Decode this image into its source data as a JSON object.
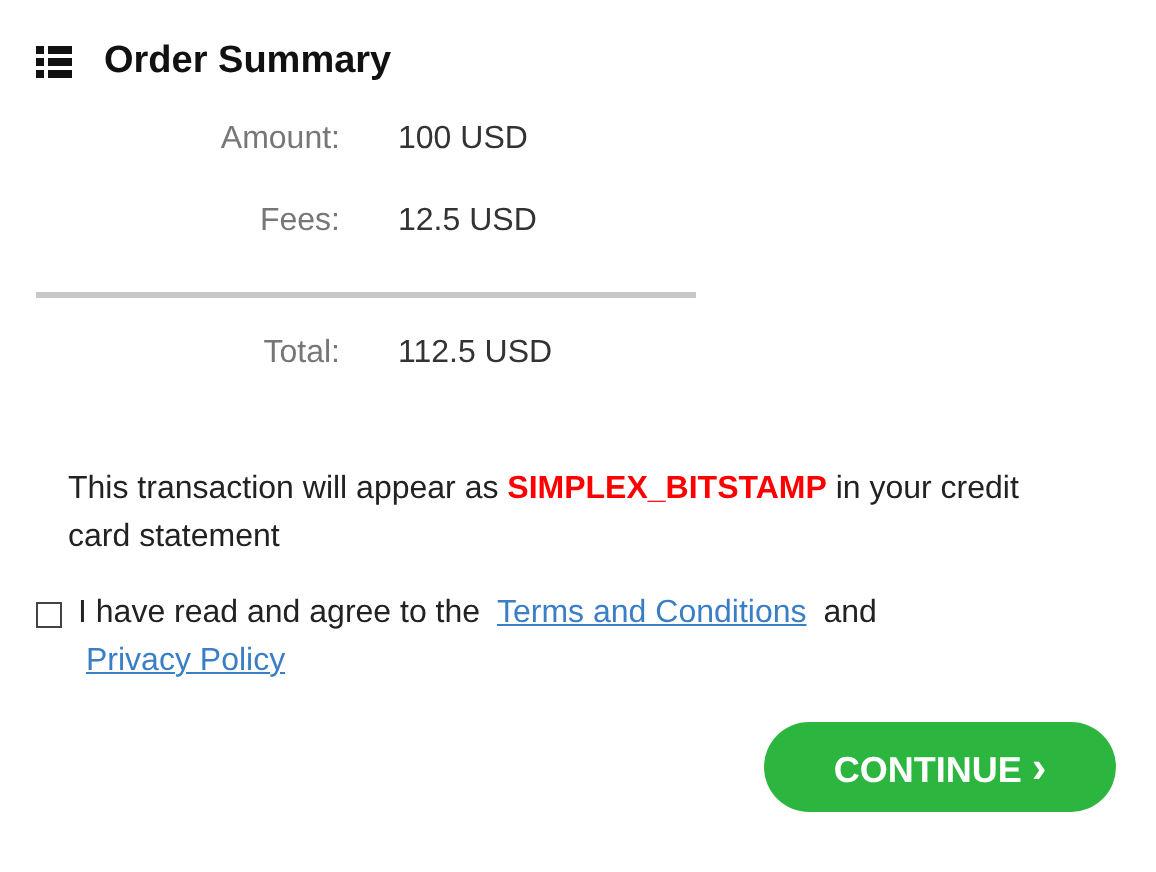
{
  "title": "Order Summary",
  "rows": [
    {
      "label": "Amount:",
      "value": "100 USD"
    },
    {
      "label": "Fees:",
      "value": "12.5 USD"
    }
  ],
  "total": {
    "label": "Total:",
    "value": "112.5 USD"
  },
  "notice": "This transaction will appear as  **SIMPLEX_BITSTAMP** in your credit card statement",
  "agreement": {
    "checked": false,
    "parts": [
      {
        "kind": "text",
        "text": "I have read and agree to the"
      },
      {
        "kind": "link",
        "text": "Terms and Conditions"
      },
      {
        "kind": "text",
        "text": "and"
      },
      {
        "kind": "link",
        "text": "Privacy Policy"
      }
    ]
  },
  "button": {
    "label": "CONTINUE",
    "icon": "›"
  }
}
